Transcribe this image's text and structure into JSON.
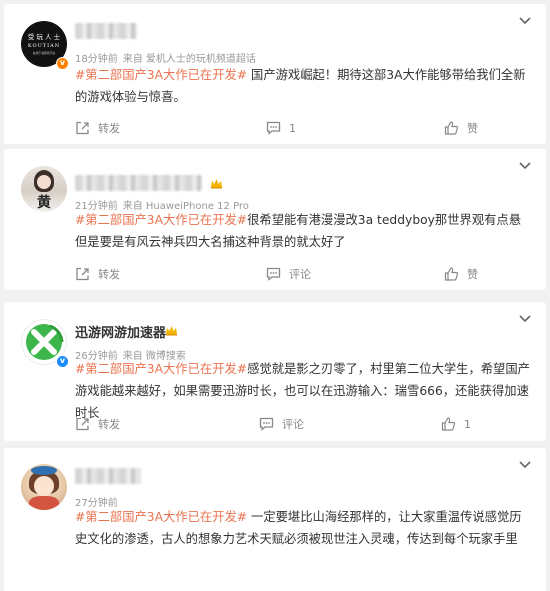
{
  "posts": [
    {
      "avatar_text_top": "受 玩 人 士",
      "avatar_text_mid": "KOUTIAN",
      "avatar_text_bot": "在线下载游戏平台",
      "time": "18分钟前",
      "source": "来自 爱机人士的玩机频道超话",
      "hashtag": "#第二部国产3A大作已在开发#",
      "body": " 国产游戏崛起！期待这部3A大作能够带给我们全新的游戏体验与惊喜。",
      "repost": "转发",
      "comments": "1",
      "like": "赞"
    },
    {
      "avatar_char": "黄",
      "time": "21分钟前",
      "source": "来自 HuaweiPhone 12 Pro",
      "hashtag": "#第二部国产3A大作已在开发#",
      "body": "很希望能有港漫漫改3a teddyboy那世界观有点悬 但是要是有风云神兵四大名捕这种背景的就太好了",
      "repost": "转发",
      "comments": "评论",
      "like": "赞"
    },
    {
      "name": "迅游网游加速器",
      "time": "26分钟前",
      "source": "来自 微博搜索",
      "hashtag": "#第二部国产3A大作已在开发#",
      "body": "感觉就是影之刃零了，村里第二位大学生，希望国产 游戏能越来越好，如果需要迅游时长，也可以在迅游输入：瑞雪666，还能获得加速时长",
      "repost": "转发",
      "comments": "评论",
      "like": "1"
    },
    {
      "time": "27分钟前",
      "hashtag": "#第二部国产3A大作已在开发#",
      "body": " 一定要堪比山海经那样的，让大家重温传说感觉历史文化的渗透，古人的想象力艺术天赋必须被现世注入灵魂，传达到每个玩家手里"
    }
  ],
  "colors": {
    "hashtag": "#eb7350",
    "vip_badge": "#ff8200",
    "xunyou_green": "#3cb54a"
  },
  "icons": [
    "chevron-down-icon",
    "repost-icon",
    "comment-icon",
    "like-icon",
    "crown-icon",
    "verified-icon"
  ]
}
